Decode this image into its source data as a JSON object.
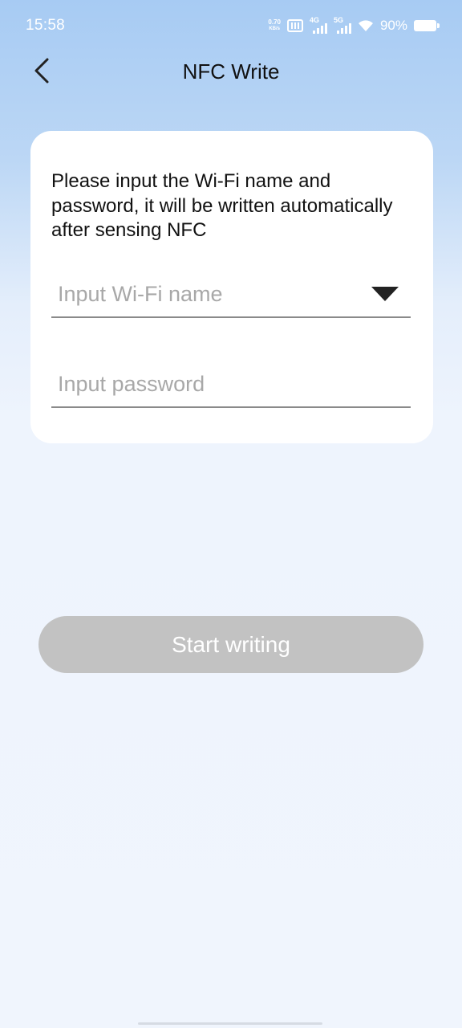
{
  "status_bar": {
    "time": "15:58",
    "net_speed_value": "0.70",
    "net_speed_unit": "KB/s",
    "signal1_label": "4G",
    "signal2_label": "5G",
    "battery_percent": "90%",
    "icons": [
      "sim-icon",
      "signal-icon",
      "wifi-icon",
      "battery-icon"
    ]
  },
  "header": {
    "back_icon": "chevron-left-icon",
    "title": "NFC Write"
  },
  "form": {
    "instruction": "Please input the Wi-Fi name and password, it will be written automatically after sensing NFC",
    "wifi_name": {
      "value": "",
      "placeholder": "Input Wi-Fi name",
      "icon": "dropdown-triangle-icon"
    },
    "password": {
      "value": "",
      "placeholder": "Input password"
    }
  },
  "actions": {
    "start_label": "Start writing",
    "start_enabled": false
  },
  "colors": {
    "title_text": "#111111",
    "placeholder": "#a8a8a8",
    "button_disabled": "#c2c2c2",
    "card_bg": "#ffffff",
    "header_gradient_top": "#a7cbf3"
  }
}
